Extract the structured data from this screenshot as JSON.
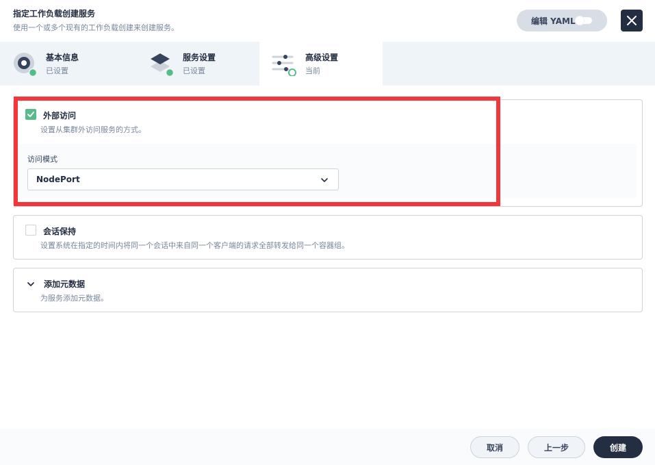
{
  "header": {
    "title": "指定工作负载创建服务",
    "subtitle": "使用一个或多个现有的工作负载创建来创建服务。",
    "yaml_label": "编辑 YAML",
    "close_icon": "close-icon"
  },
  "steps": [
    {
      "title": "基本信息",
      "status": "已设置",
      "icon": "basic-info-icon"
    },
    {
      "title": "服务设置",
      "status": "已设置",
      "icon": "service-settings-icon"
    },
    {
      "title": "高级设置",
      "status": "当前",
      "icon": "advanced-settings-icon"
    }
  ],
  "external_access": {
    "title": "外部访问",
    "description": "设置从集群外访问服务的方式。",
    "checked": true,
    "mode_label": "访问模式",
    "mode_value": "NodePort"
  },
  "session_affinity": {
    "title": "会话保持",
    "description": "设置系统在指定的时间内将同一个会话中来自同一个客户端的请求全部转发给同一个容器组。",
    "checked": false
  },
  "metadata": {
    "title": "添加元数据",
    "description": "为服务添加元数据。"
  },
  "footer": {
    "cancel": "取消",
    "previous": "上一步",
    "create": "创建"
  },
  "colors": {
    "primary_dark": "#242e42",
    "success_green": "#55bc8a",
    "highlight_red": "#f2373c"
  }
}
